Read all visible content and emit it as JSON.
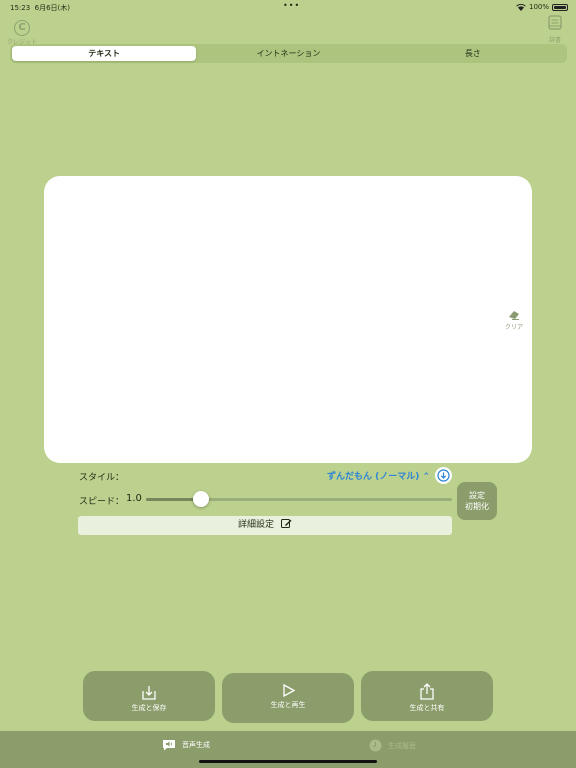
{
  "status": {
    "time": "15:23",
    "date": "6月6日(木)",
    "battery": "100%"
  },
  "nav": {
    "credit_label": "クレジット",
    "dictionary_label": "辞書"
  },
  "segments": {
    "items": [
      "テキスト",
      "イントネーション",
      "長さ"
    ],
    "selected": 0
  },
  "editor": {
    "value": "",
    "clear_label": "クリア"
  },
  "settings": {
    "style_label": "スタイル：",
    "voice": "ずんだもん (ノーマル)",
    "speed_label": "スピード：",
    "speed_value": "1.0",
    "speed_fraction": 0.18,
    "reset_line1": "設定",
    "reset_line2": "初期化",
    "detail_label": "詳細設定"
  },
  "actions": {
    "save_label": "生成と保存",
    "play_label": "生成と再生",
    "share_label": "生成と共有"
  },
  "tabbar": {
    "tab1_label": "音声生成",
    "tab2_label": "生成履歴"
  },
  "colors": {
    "background": "#bbd18d",
    "button": "#8a9d6a",
    "accent": "#2e84d6"
  }
}
